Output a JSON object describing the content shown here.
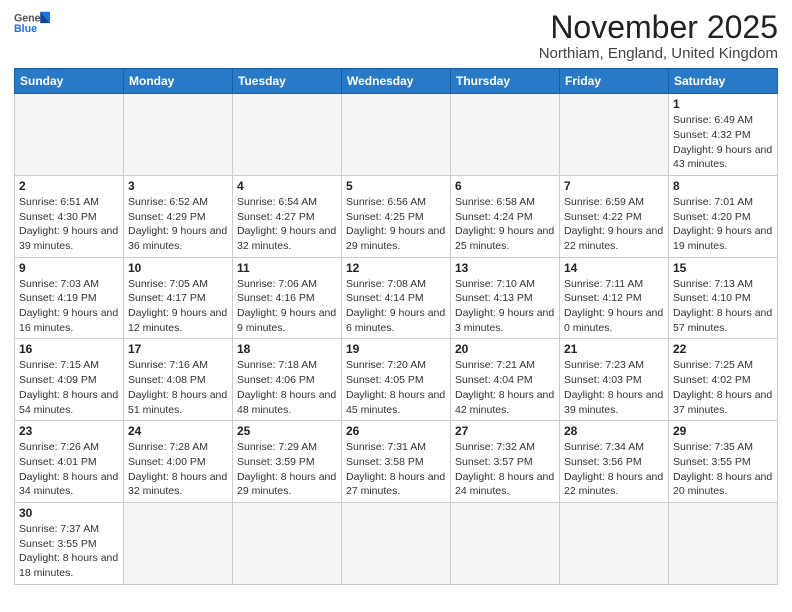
{
  "logo": {
    "text_general": "General",
    "text_blue": "Blue"
  },
  "header": {
    "title": "November 2025",
    "subtitle": "Northiam, England, United Kingdom"
  },
  "weekdays": [
    "Sunday",
    "Monday",
    "Tuesday",
    "Wednesday",
    "Thursday",
    "Friday",
    "Saturday"
  ],
  "weeks": [
    [
      {
        "day": "",
        "info": ""
      },
      {
        "day": "",
        "info": ""
      },
      {
        "day": "",
        "info": ""
      },
      {
        "day": "",
        "info": ""
      },
      {
        "day": "",
        "info": ""
      },
      {
        "day": "",
        "info": ""
      },
      {
        "day": "1",
        "info": "Sunrise: 6:49 AM\nSunset: 4:32 PM\nDaylight: 9 hours and 43 minutes."
      }
    ],
    [
      {
        "day": "2",
        "info": "Sunrise: 6:51 AM\nSunset: 4:30 PM\nDaylight: 9 hours and 39 minutes."
      },
      {
        "day": "3",
        "info": "Sunrise: 6:52 AM\nSunset: 4:29 PM\nDaylight: 9 hours and 36 minutes."
      },
      {
        "day": "4",
        "info": "Sunrise: 6:54 AM\nSunset: 4:27 PM\nDaylight: 9 hours and 32 minutes."
      },
      {
        "day": "5",
        "info": "Sunrise: 6:56 AM\nSunset: 4:25 PM\nDaylight: 9 hours and 29 minutes."
      },
      {
        "day": "6",
        "info": "Sunrise: 6:58 AM\nSunset: 4:24 PM\nDaylight: 9 hours and 25 minutes."
      },
      {
        "day": "7",
        "info": "Sunrise: 6:59 AM\nSunset: 4:22 PM\nDaylight: 9 hours and 22 minutes."
      },
      {
        "day": "8",
        "info": "Sunrise: 7:01 AM\nSunset: 4:20 PM\nDaylight: 9 hours and 19 minutes."
      }
    ],
    [
      {
        "day": "9",
        "info": "Sunrise: 7:03 AM\nSunset: 4:19 PM\nDaylight: 9 hours and 16 minutes."
      },
      {
        "day": "10",
        "info": "Sunrise: 7:05 AM\nSunset: 4:17 PM\nDaylight: 9 hours and 12 minutes."
      },
      {
        "day": "11",
        "info": "Sunrise: 7:06 AM\nSunset: 4:16 PM\nDaylight: 9 hours and 9 minutes."
      },
      {
        "day": "12",
        "info": "Sunrise: 7:08 AM\nSunset: 4:14 PM\nDaylight: 9 hours and 6 minutes."
      },
      {
        "day": "13",
        "info": "Sunrise: 7:10 AM\nSunset: 4:13 PM\nDaylight: 9 hours and 3 minutes."
      },
      {
        "day": "14",
        "info": "Sunrise: 7:11 AM\nSunset: 4:12 PM\nDaylight: 9 hours and 0 minutes."
      },
      {
        "day": "15",
        "info": "Sunrise: 7:13 AM\nSunset: 4:10 PM\nDaylight: 8 hours and 57 minutes."
      }
    ],
    [
      {
        "day": "16",
        "info": "Sunrise: 7:15 AM\nSunset: 4:09 PM\nDaylight: 8 hours and 54 minutes."
      },
      {
        "day": "17",
        "info": "Sunrise: 7:16 AM\nSunset: 4:08 PM\nDaylight: 8 hours and 51 minutes."
      },
      {
        "day": "18",
        "info": "Sunrise: 7:18 AM\nSunset: 4:06 PM\nDaylight: 8 hours and 48 minutes."
      },
      {
        "day": "19",
        "info": "Sunrise: 7:20 AM\nSunset: 4:05 PM\nDaylight: 8 hours and 45 minutes."
      },
      {
        "day": "20",
        "info": "Sunrise: 7:21 AM\nSunset: 4:04 PM\nDaylight: 8 hours and 42 minutes."
      },
      {
        "day": "21",
        "info": "Sunrise: 7:23 AM\nSunset: 4:03 PM\nDaylight: 8 hours and 39 minutes."
      },
      {
        "day": "22",
        "info": "Sunrise: 7:25 AM\nSunset: 4:02 PM\nDaylight: 8 hours and 37 minutes."
      }
    ],
    [
      {
        "day": "23",
        "info": "Sunrise: 7:26 AM\nSunset: 4:01 PM\nDaylight: 8 hours and 34 minutes."
      },
      {
        "day": "24",
        "info": "Sunrise: 7:28 AM\nSunset: 4:00 PM\nDaylight: 8 hours and 32 minutes."
      },
      {
        "day": "25",
        "info": "Sunrise: 7:29 AM\nSunset: 3:59 PM\nDaylight: 8 hours and 29 minutes."
      },
      {
        "day": "26",
        "info": "Sunrise: 7:31 AM\nSunset: 3:58 PM\nDaylight: 8 hours and 27 minutes."
      },
      {
        "day": "27",
        "info": "Sunrise: 7:32 AM\nSunset: 3:57 PM\nDaylight: 8 hours and 24 minutes."
      },
      {
        "day": "28",
        "info": "Sunrise: 7:34 AM\nSunset: 3:56 PM\nDaylight: 8 hours and 22 minutes."
      },
      {
        "day": "29",
        "info": "Sunrise: 7:35 AM\nSunset: 3:55 PM\nDaylight: 8 hours and 20 minutes."
      }
    ],
    [
      {
        "day": "30",
        "info": "Sunrise: 7:37 AM\nSunset: 3:55 PM\nDaylight: 8 hours and 18 minutes."
      },
      {
        "day": "",
        "info": ""
      },
      {
        "day": "",
        "info": ""
      },
      {
        "day": "",
        "info": ""
      },
      {
        "day": "",
        "info": ""
      },
      {
        "day": "",
        "info": ""
      },
      {
        "day": "",
        "info": ""
      }
    ]
  ]
}
